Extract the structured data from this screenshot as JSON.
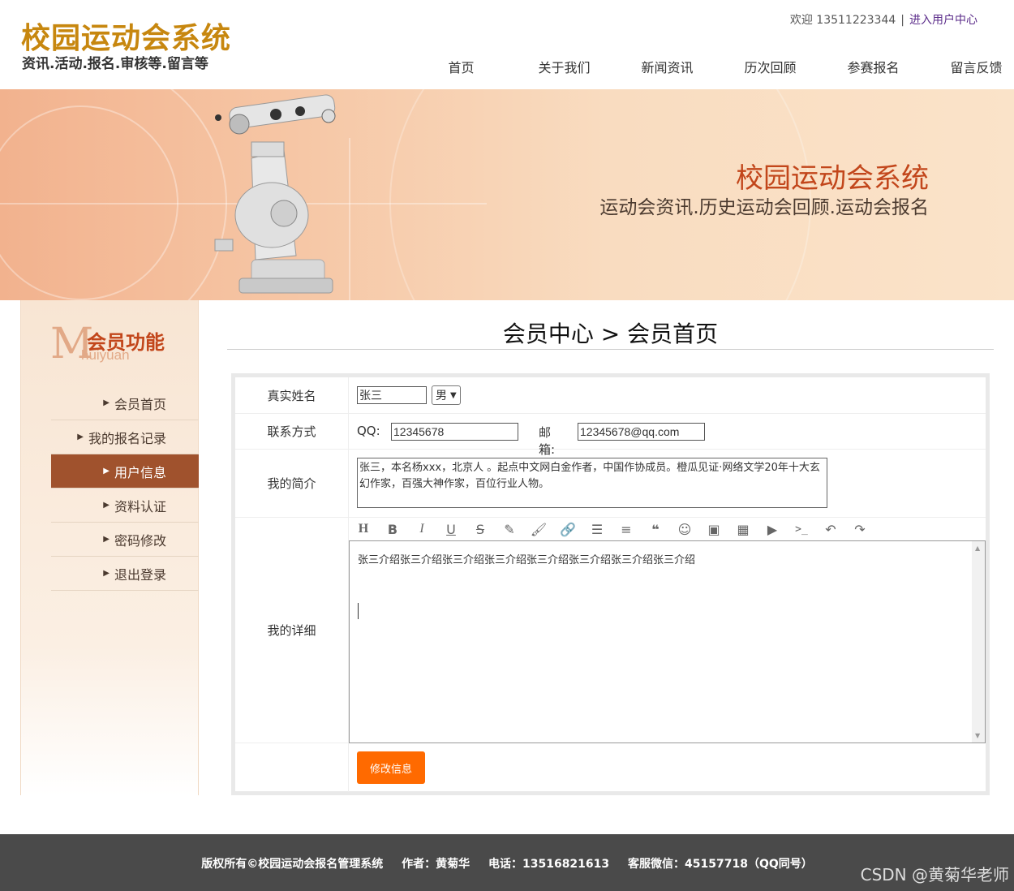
{
  "header": {
    "logo_title": "校园运动会系统",
    "logo_subtitle": "资讯.活动.报名.审核等.留言等",
    "welcome_text": "欢迎 13511223344",
    "separator": "|",
    "user_center_link": "进入用户中心",
    "nav": [
      "首页",
      "关于我们",
      "新闻资讯",
      "历次回顾",
      "参赛报名",
      "留言反馈"
    ]
  },
  "banner": {
    "title": "校园运动会系统",
    "subtitle": "运动会资讯.历史运动会回顾.运动会报名"
  },
  "sidebar": {
    "logo_letter": "M",
    "title": "会员功能",
    "pinyin": "huiyuan",
    "items": [
      {
        "label": "会员首页",
        "active": false
      },
      {
        "label": "我的报名记录",
        "active": false
      },
      {
        "label": "用户信息",
        "active": true
      },
      {
        "label": "资料认证",
        "active": false
      },
      {
        "label": "密码修改",
        "active": false
      },
      {
        "label": "退出登录",
        "active": false
      }
    ]
  },
  "main": {
    "page_title": "会员中心 > 会员首页",
    "form": {
      "name_label": "真实姓名",
      "name_value": "张三",
      "gender_value": "男",
      "contact_label": "联系方式",
      "qq_label": "QQ:",
      "qq_value": "12345678",
      "email_label": "邮箱:",
      "email_value": "12345678@qq.com",
      "intro_label": "我的简介",
      "intro_value": "张三，本名杨xxx，北京人 。起点中文网白金作者，中国作协成员。橙瓜见证·网络文学20年十大玄幻作家，百强大神作家，百位行业人物。",
      "detail_label": "我的详细",
      "detail_value": "张三介绍张三介绍张三介绍张三介绍张三介绍张三介绍张三介绍张三介绍",
      "submit_label": "修改信息"
    },
    "toolbar_icons": [
      "heading-icon",
      "bold-icon",
      "italic-icon",
      "underline-icon",
      "strikethrough-icon",
      "marker-icon",
      "brush-icon",
      "link-icon",
      "list-icon",
      "align-icon",
      "quote-icon",
      "emoji-icon",
      "image-icon",
      "table-icon",
      "video-icon",
      "code-icon",
      "undo-icon",
      "redo-icon"
    ]
  },
  "footer": {
    "copyright": "版权所有©校园运动会报名管理系统",
    "author": "作者：黄菊华",
    "phone": "电话：13516821613",
    "wechat": "客服微信：45157718（QQ同号）"
  },
  "watermark": "CSDN @黄菊华老师",
  "colors": {
    "brand_gold": "#c7870f",
    "banner_title": "#c2461b",
    "sidebar_active": "#a0522d",
    "submit_button": "#ff6a00",
    "footer_bg": "#4a4a4a"
  }
}
